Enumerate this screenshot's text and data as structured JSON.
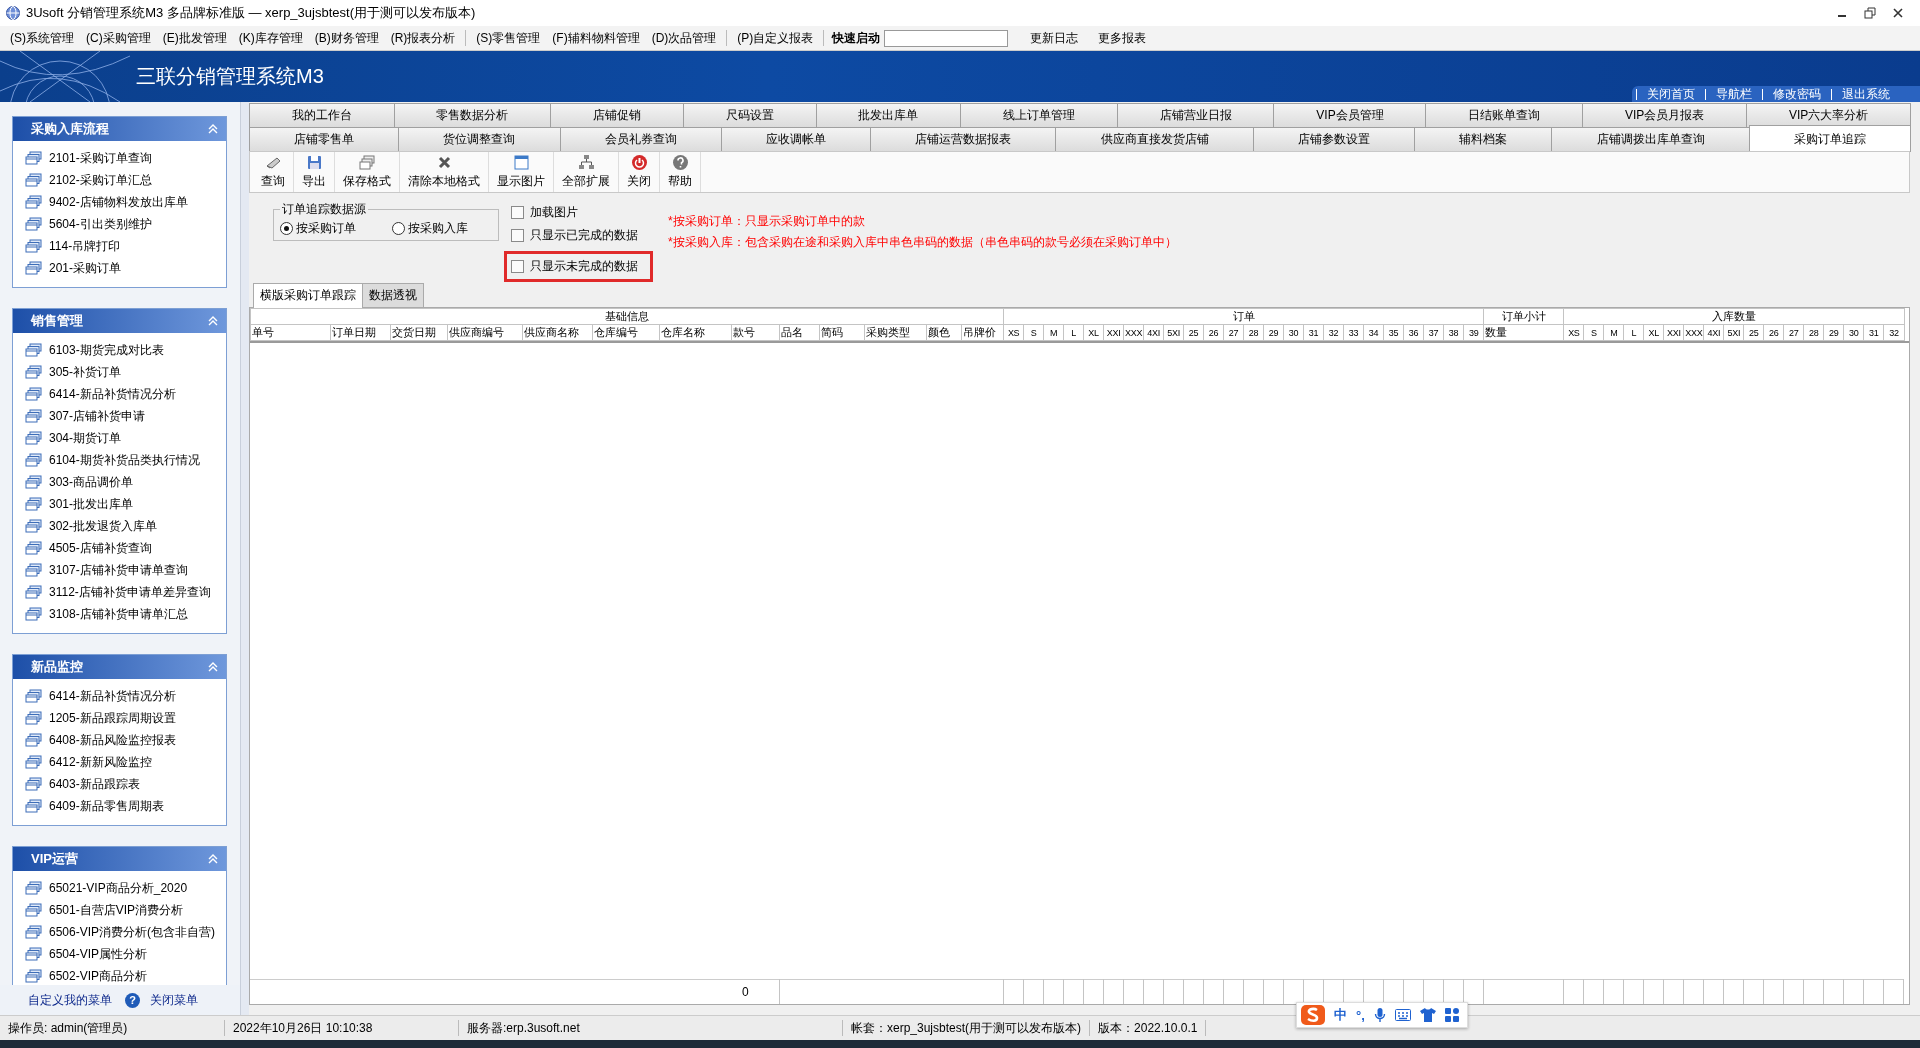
{
  "window": {
    "title": "3Usoft 分销管理系统M3 多品牌标准版 — xerp_3ujsbtest(用于测可以发布版本)"
  },
  "menu_bar": {
    "groups": [
      [
        "(S)系统管理",
        "(C)采购管理",
        "(E)批发管理",
        "(K)库存管理",
        "(B)财务管理",
        "(R)报表分析"
      ],
      [
        "(S)零售管理",
        "(F)辅料物料管理",
        "(D)次品管理"
      ],
      [
        "(P)自定义报表"
      ]
    ],
    "quick_launch": {
      "label": "快速启动"
    },
    "links": [
      "更新日志",
      "更多报表"
    ]
  },
  "banner": {
    "title": "三联分销管理系统M3",
    "links": [
      "关闭首页",
      "导航栏",
      "修改密码",
      "退出系统"
    ]
  },
  "sidebar": {
    "panels": [
      {
        "title": "采购入库流程",
        "expanded": true,
        "items": [
          "2101-采购订单查询",
          "2102-采购订单汇总",
          "9402-店铺物料发放出库单",
          "5604-引出类别维护",
          "114-吊牌打印",
          "201-采购订单"
        ]
      },
      {
        "title": "销售管理",
        "expanded": true,
        "items": [
          "6103-期货完成对比表",
          "305-补货订单",
          "6414-新品补货情况分析",
          "307-店铺补货申请",
          "304-期货订单",
          "6104-期货补货品类执行情况",
          "303-商品调价单",
          "301-批发出库单",
          "302-批发退货入库单",
          "4505-店铺补货查询",
          "3107-店铺补货申请单查询",
          "3112-店铺补货申请单差异查询",
          "3108-店铺补货申请单汇总"
        ]
      },
      {
        "title": "新品监控",
        "expanded": true,
        "items": [
          "6414-新品补货情况分析",
          "1205-新品跟踪周期设置",
          "6408-新品风险监控报表",
          "6412-新新风险监控",
          "6403-新品跟踪表",
          "6409-新品零售周期表"
        ]
      },
      {
        "title": "VIP运营",
        "expanded": true,
        "items": [
          "65021-VIP商品分析_2020",
          "6501-自营店VIP消费分析",
          "6506-VIP消费分析(包含非自营)",
          "6504-VIP属性分析",
          "6502-VIP商品分析"
        ]
      }
    ],
    "footer": {
      "customize": "自定义我的菜单",
      "help": "?",
      "close": "关闭菜单"
    }
  },
  "tabs": {
    "upper_row": [
      {
        "label": "我的工作台",
        "selected": false
      },
      {
        "label": "零售数据分析",
        "selected": false
      },
      {
        "label": "店铺促销",
        "selected": false
      },
      {
        "label": "尺码设置",
        "selected": false
      },
      {
        "label": "批发出库单",
        "selected": false
      },
      {
        "label": "线上订单管理",
        "selected": false
      },
      {
        "label": "店铺营业日报",
        "selected": false
      },
      {
        "label": "VIP会员管理",
        "selected": false
      },
      {
        "label": "日结账单查询",
        "selected": false
      },
      {
        "label": "VIP会员月报表",
        "selected": false
      },
      {
        "label": "VIP六大率分析",
        "selected": false
      }
    ],
    "lower_row": [
      {
        "label": "店铺零售单",
        "selected": false
      },
      {
        "label": "货位调整查询",
        "selected": false
      },
      {
        "label": "会员礼券查询",
        "selected": false
      },
      {
        "label": "应收调帐单",
        "selected": false
      },
      {
        "label": "店铺运营数据报表",
        "selected": false
      },
      {
        "label": "供应商直接发货店铺",
        "selected": false
      },
      {
        "label": "店铺参数设置",
        "selected": false
      },
      {
        "label": "辅料档案",
        "selected": false
      },
      {
        "label": "店铺调拨出库单查询",
        "selected": false
      },
      {
        "label": "采购订单追踪",
        "selected": true
      }
    ]
  },
  "toolbar": {
    "buttons": [
      {
        "label": "查询",
        "kind": "query"
      },
      {
        "label": "导出",
        "kind": "export"
      },
      {
        "label": "保存格式",
        "kind": "save"
      },
      {
        "label": "清除本地格式",
        "kind": "clear"
      },
      {
        "label": "显示图片",
        "kind": "image"
      },
      {
        "label": "全部扩展",
        "kind": "expand"
      },
      {
        "label": "关闭",
        "kind": "close"
      },
      {
        "label": "帮助",
        "kind": "help"
      }
    ]
  },
  "options": {
    "source_group": {
      "title": "订单追踪数据源",
      "radios": [
        {
          "label": "按采购订单",
          "selected": true
        },
        {
          "label": "按采购入库",
          "selected": false
        }
      ]
    },
    "checkboxes": [
      {
        "label": "加载图片",
        "checked": false,
        "highlighted": false
      },
      {
        "label": "只显示已完成的数据",
        "checked": false,
        "highlighted": false
      },
      {
        "label": "只显示未完成的数据",
        "checked": false,
        "highlighted": true
      }
    ],
    "notes": [
      "*按采购订单：只显示采购订单中的款",
      "*按采购入库：包含采购在途和采购入库中串色串码的数据（串色串码的款号必须在采购订单中）"
    ]
  },
  "grid": {
    "tabs": [
      {
        "label": "横版采购订单跟踪",
        "selected": true
      },
      {
        "label": "数据透视",
        "selected": false
      }
    ],
    "column_groups": [
      {
        "title": "基础信息",
        "kind": "base",
        "columns": [
          "单号",
          "订单日期",
          "交货日期",
          "供应商编号",
          "供应商名称",
          "仓库编号",
          "仓库名称",
          "款号",
          "品名",
          "简码",
          "采购类型",
          "颜色",
          "吊牌价"
        ]
      },
      {
        "title": "订单",
        "kind": "size",
        "columns": [
          "XS",
          "S",
          "M",
          "L",
          "XL",
          "XXI",
          "XXX",
          "4XI",
          "5XI",
          "25",
          "26",
          "27",
          "28",
          "29",
          "30",
          "31",
          "32",
          "33",
          "34",
          "35",
          "36",
          "37",
          "38",
          "39"
        ]
      },
      {
        "title": "订单小计",
        "kind": "total",
        "columns": [
          "数量"
        ]
      },
      {
        "title": "入库数量",
        "kind": "size",
        "columns": [
          "XS",
          "S",
          "M",
          "L",
          "XL",
          "XXI",
          "XXX",
          "4XI",
          "5XI",
          "25",
          "26",
          "27",
          "28",
          "29",
          "30",
          "31",
          "32"
        ]
      }
    ],
    "footer_total": "0"
  },
  "status_bar": {
    "fields": [
      "操作员: admin(管理员)",
      "2022年10月26日 10:10:38",
      "服务器:erp.3usoft.net",
      "帐套：xerp_3ujsbtest(用于测可以发布版本)",
      "版本：2022.10.0.1"
    ]
  },
  "ime_bar": {
    "mode": "中",
    "punctuation": "°,"
  }
}
